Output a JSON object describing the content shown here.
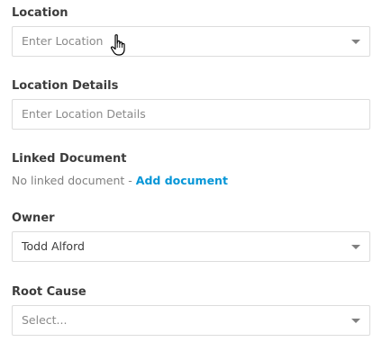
{
  "location": {
    "label": "Location",
    "placeholder": "Enter Location"
  },
  "location_details": {
    "label": "Location Details",
    "placeholder": "Enter Location Details"
  },
  "linked_document": {
    "label": "Linked Document",
    "empty_text": "No linked document",
    "separator": " - ",
    "add_link": "Add document"
  },
  "owner": {
    "label": "Owner",
    "value": "Todd Alford"
  },
  "root_cause": {
    "label": "Root Cause",
    "placeholder": "Select..."
  },
  "icons": {
    "dropdown": "caret-down-icon",
    "pointer": "hand-pointer-icon"
  },
  "colors": {
    "link": "#0696d7",
    "border": "#dcdcdc",
    "label": "#3c3c3c",
    "placeholder": "#8a8a8a"
  }
}
